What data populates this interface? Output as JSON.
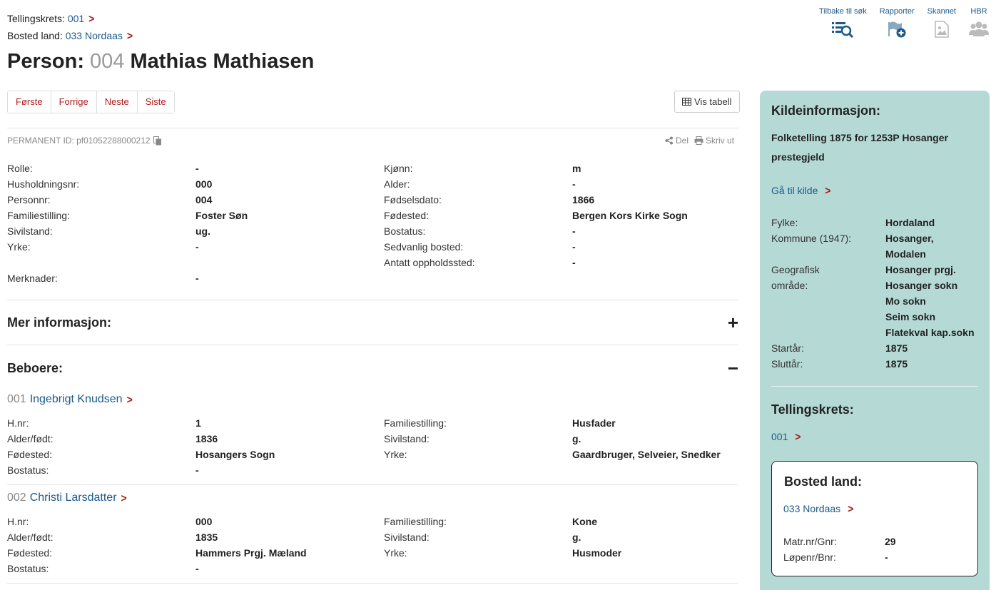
{
  "breadcrumbs": {
    "tellingskrets_label": "Tellingskrets:",
    "tellingskrets_value": "001",
    "bosted_label": "Bosted land:",
    "bosted_value": "033 Nordaas"
  },
  "toolbar": {
    "back": "Tilbake til søk",
    "reports": "Rapporter",
    "scanned": "Skannet",
    "hbr": "HBR"
  },
  "title": {
    "prefix": "Person:",
    "number": "004",
    "name": "Mathias Mathiasen"
  },
  "pager": {
    "first": "Første",
    "prev": "Forrige",
    "next": "Neste",
    "last": "Siste"
  },
  "vis_tabell": "Vis tabell",
  "permanent_id": "PERMANENT ID: pf01052288000212",
  "share": {
    "del": "Del",
    "print": "Skriv ut"
  },
  "person_fields": [
    {
      "l1": "Rolle:",
      "v1": "-",
      "l2": "Kjønn:",
      "v2": "m"
    },
    {
      "l1": "Husholdningsnr:",
      "v1": "000",
      "l2": "Alder:",
      "v2": "-"
    },
    {
      "l1": "Personnr:",
      "v1": "004",
      "l2": "Fødselsdato:",
      "v2": "1866"
    },
    {
      "l1": "Familiestilling:",
      "v1": "Foster Søn",
      "l2": "Fødested:",
      "v2": "Bergen Kors Kirke Sogn"
    },
    {
      "l1": "Sivilstand:",
      "v1": "ug.",
      "l2": "Bostatus:",
      "v2": "-"
    },
    {
      "l1": "Yrke:",
      "v1": "-",
      "l2": "Sedvanlig bosted:",
      "v2": "-"
    },
    {
      "l1": "",
      "v1": "",
      "l2": "Antatt oppholdssted:",
      "v2": "-"
    },
    {
      "l1": "Merknader:",
      "v1": "-",
      "l2": "",
      "v2": ""
    }
  ],
  "mer_info": {
    "label": "Mer informasjon:",
    "toggle": "+"
  },
  "beboere": {
    "label": "Beboere:",
    "toggle": "−"
  },
  "residents": [
    {
      "num": "001",
      "name": "Ingebrigt Knudsen",
      "fields": [
        {
          "l1": "H.nr:",
          "v1": "1",
          "l2": "Familiestilling:",
          "v2": "Husfader"
        },
        {
          "l1": "Alder/født:",
          "v1": "1836",
          "l2": "Sivilstand:",
          "v2": "g."
        },
        {
          "l1": "Fødested:",
          "v1": "Hosangers Sogn",
          "l2": "Yrke:",
          "v2": "Gaardbruger, Selveier, Snedker"
        },
        {
          "l1": "Bostatus:",
          "v1": "-",
          "l2": "",
          "v2": ""
        }
      ]
    },
    {
      "num": "002",
      "name": "Christi Larsdatter",
      "fields": [
        {
          "l1": "H.nr:",
          "v1": "000",
          "l2": "Familiestilling:",
          "v2": "Kone"
        },
        {
          "l1": "Alder/født:",
          "v1": "1835",
          "l2": "Sivilstand:",
          "v2": "g."
        },
        {
          "l1": "Fødested:",
          "v1": "Hammers Prgj. Mæland",
          "l2": "Yrke:",
          "v2": "Husmoder"
        },
        {
          "l1": "Bostatus:",
          "v1": "-",
          "l2": "",
          "v2": ""
        }
      ]
    }
  ],
  "sidebar": {
    "heading": "Kildeinformasjon:",
    "source_title": "Folketelling 1875 for 1253P Hosanger prestegjeld",
    "go_to_source": "Gå til kilde",
    "info": [
      {
        "k": "Fylke:",
        "v": "Hordaland"
      },
      {
        "k": "Kommune (1947):",
        "v": "Hosanger,"
      },
      {
        "k": "",
        "v": "Modalen"
      },
      {
        "k": "Geografisk",
        "v": "Hosanger prgj."
      },
      {
        "k": "område:",
        "v": "Hosanger sokn"
      },
      {
        "k": "",
        "v": "Mo sokn"
      },
      {
        "k": "",
        "v": "Seim sokn"
      },
      {
        "k": "",
        "v": "Flatekval kap.sokn"
      },
      {
        "k": "Startår:",
        "v": "1875"
      },
      {
        "k": "Sluttår:",
        "v": "1875"
      }
    ],
    "tellingskrets_heading": "Tellingskrets:",
    "tellingskrets_link": "001",
    "bosted_heading": "Bosted land:",
    "bosted_link": "033 Nordaas",
    "bosted_info": [
      {
        "k": "Matr.nr/Gnr:",
        "v": "29"
      },
      {
        "k": "Løpenr/Bnr:",
        "v": "-"
      }
    ]
  }
}
